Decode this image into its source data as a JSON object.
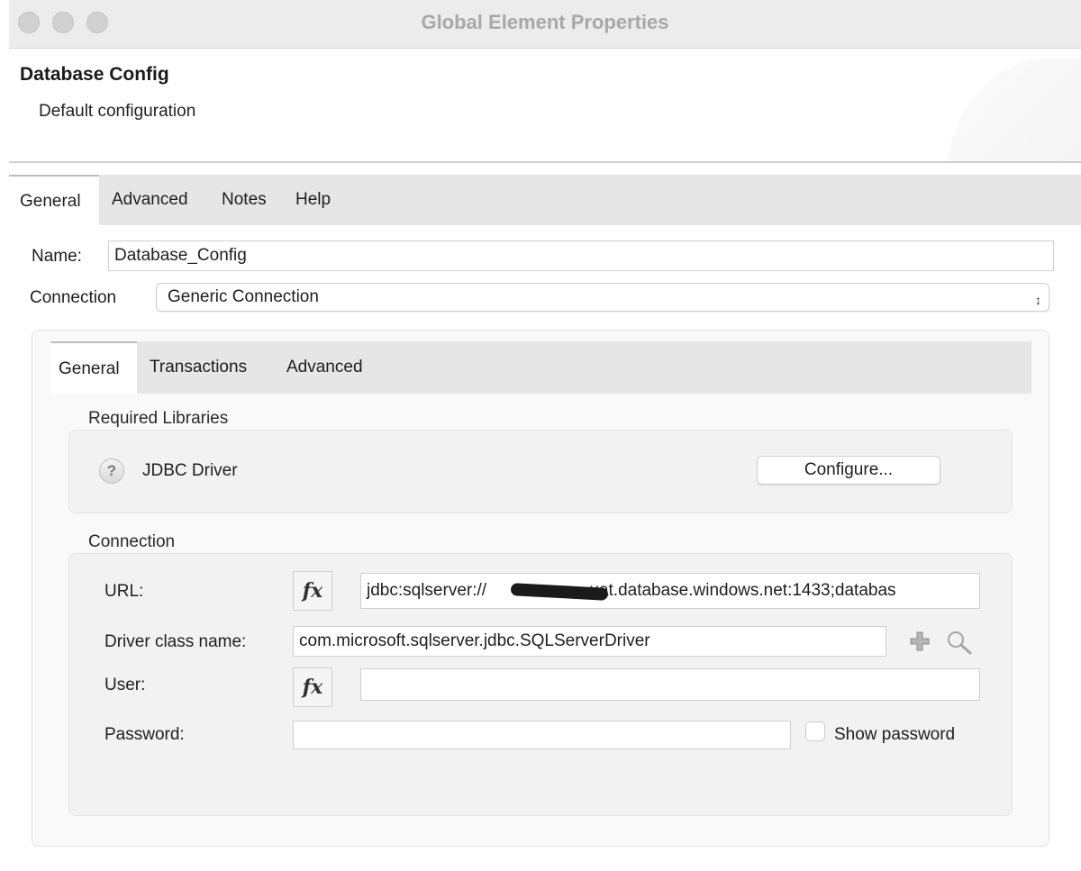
{
  "window": {
    "title": "Global Element Properties"
  },
  "header": {
    "title": "Database Config",
    "subtitle": "Default configuration"
  },
  "outer_tabs": [
    {
      "label": "General",
      "active": true
    },
    {
      "label": "Advanced",
      "active": false
    },
    {
      "label": "Notes",
      "active": false
    },
    {
      "label": "Help",
      "active": false
    }
  ],
  "name_field": {
    "label": "Name:",
    "value": "Database_Config"
  },
  "connection_select": {
    "label": "Connection",
    "value": "Generic Connection"
  },
  "inner_tabs": [
    {
      "label": "General",
      "active": true
    },
    {
      "label": "Transactions",
      "active": false
    },
    {
      "label": "Advanced",
      "active": false
    }
  ],
  "required_libraries": {
    "title": "Required Libraries",
    "driver_label": "JDBC Driver",
    "help_glyph": "?",
    "configure_button": "Configure..."
  },
  "connection_section": {
    "title": "Connection",
    "url": {
      "label": "URL:",
      "fx": "fx",
      "value_prefix": "jdbc:sqlserver://",
      "value_suffix": "-uat.database.windows.net:1433;databas"
    },
    "driver_class": {
      "label": "Driver class name:",
      "value": "com.microsoft.sqlserver.jdbc.SQLServerDriver"
    },
    "user": {
      "label": "User:",
      "fx": "fx",
      "value": ""
    },
    "password": {
      "label": "Password:",
      "value": "",
      "show_password_label": "Show password",
      "show_password_checked": false
    }
  },
  "icons": {
    "help": "question-circle-icon",
    "fx": "function-expression-icon",
    "plus": "plus-icon",
    "search": "magnifier-icon"
  },
  "colors": {
    "tab_bar": "#e6e6e6",
    "panel_bg": "#f9f9f9",
    "group_bg": "#f2f2f2",
    "plus_icon": "#9a9a9a"
  }
}
